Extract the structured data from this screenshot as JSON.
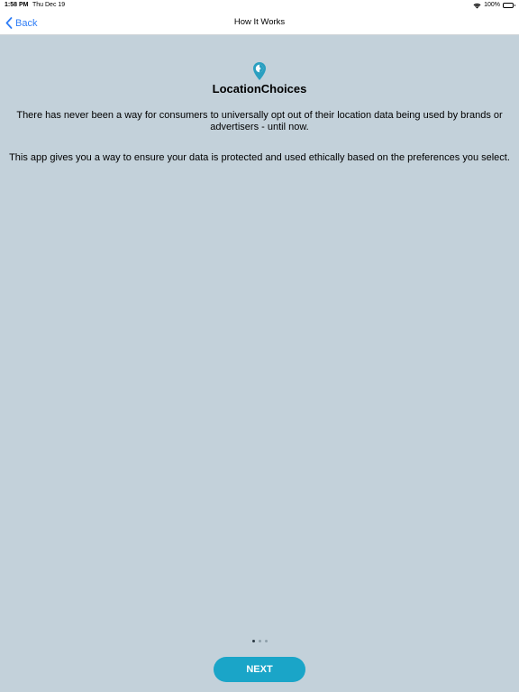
{
  "status_bar": {
    "time": "1:58 PM",
    "date": "Thu Dec 19",
    "battery": "100%",
    "icons": [
      "wifi-icon",
      "battery-icon"
    ]
  },
  "nav": {
    "back_label": "Back",
    "title": "How It Works",
    "back_icon": "chevron-left-icon"
  },
  "main": {
    "logo_icon": "location-pin-icon",
    "app_name": "LocationChoices",
    "paragraphs": [
      "There has never been a way for consumers to universally opt out of their location data being used by brands or advertisers - until now.",
      "This app gives you a way to ensure your data is protected and used ethically based on the preferences you select."
    ]
  },
  "pager": {
    "total": 3,
    "active_index": 0
  },
  "footer": {
    "next_label": "NEXT"
  },
  "colors": {
    "background": "#c3d1da",
    "accent": "#1aa5c8",
    "ios_blue": "#2f7df6",
    "logo": "#2a9fc0"
  }
}
